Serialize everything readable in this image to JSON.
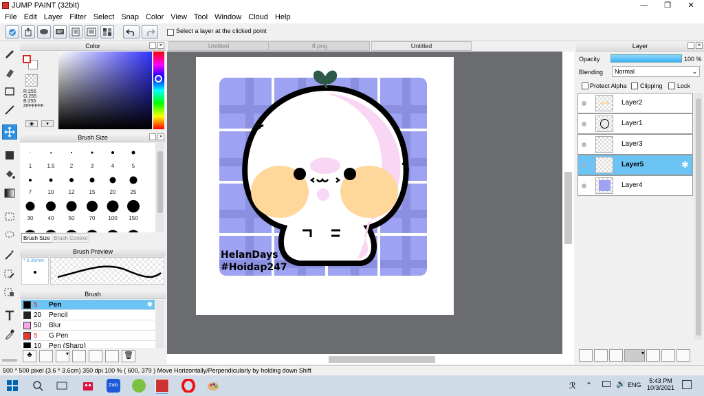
{
  "window": {
    "title": "JUMP PAINT (32bit)",
    "minimize": "—",
    "maximize": "❐",
    "close": "✕"
  },
  "menu": [
    "File",
    "Edit",
    "Layer",
    "Filter",
    "Select",
    "Snap",
    "Color",
    "View",
    "Tool",
    "Window",
    "Cloud",
    "Help"
  ],
  "toolbar": {
    "select_layer_label": "Select a layer at the clicked point"
  },
  "color_panel": {
    "title": "Color",
    "rgb": [
      "R:255",
      "G:255",
      "B:255"
    ],
    "hex": "#FFFFFF"
  },
  "brush_size_panel": {
    "title": "Brush Size",
    "sizes": [
      "1",
      "1.5",
      "2",
      "3",
      "4",
      "5",
      "7",
      "10",
      "12",
      "15",
      "20",
      "25",
      "30",
      "40",
      "50",
      "70",
      "100",
      "150"
    ],
    "tab_active": "Brush Size",
    "tab_inactive": "Brush Control"
  },
  "brush_preview_panel": {
    "title": "Brush Preview",
    "size_label": "* 0.36mm"
  },
  "brush_panel": {
    "title": "Brush",
    "items": [
      {
        "num": "5",
        "name": "Pen",
        "color": "#000000"
      },
      {
        "num": "20",
        "name": "Pencil",
        "color": "#000000"
      },
      {
        "num": "50",
        "name": "Blur",
        "color": "#f7a8e8"
      },
      {
        "num": "5",
        "name": "G Pen",
        "color": "#ee3333"
      },
      {
        "num": "10",
        "name": "Pen (Sharp)",
        "color": "#000000"
      }
    ]
  },
  "tabs": [
    "Untitled",
    "ff.png",
    "Untitled"
  ],
  "canvas": {
    "text_line1": "HelanDays",
    "text_line2": "#Hoidap247"
  },
  "layer_panel": {
    "title": "Layer",
    "opacity_label": "Opacity",
    "opacity_value": "100 %",
    "blending_label": "Blending",
    "blending_value": "Normal",
    "protect_alpha": "Protect Alpha",
    "clipping": "Clipping",
    "lock": "Lock",
    "layers": [
      "Layer2",
      "Layer1",
      "Layer3",
      "Layer5",
      "Layer4"
    ]
  },
  "status": {
    "text": "500 * 500 pixel   (3.6 * 3.6cm)   350 dpi   100 %   ( 600, 379 )   Move Horizontally/Perpendicularly by holding down Shift"
  },
  "taskbar": {
    "lang": "ENG",
    "time": "5:43 PM",
    "date": "10/3/2021"
  },
  "colors": {
    "accent": "#6cc4f5",
    "canvas_bg": "#6a6c70",
    "grid_purple": "#9da3f2",
    "cheek": "#ffd79a",
    "blush": "#f9d6f3"
  }
}
